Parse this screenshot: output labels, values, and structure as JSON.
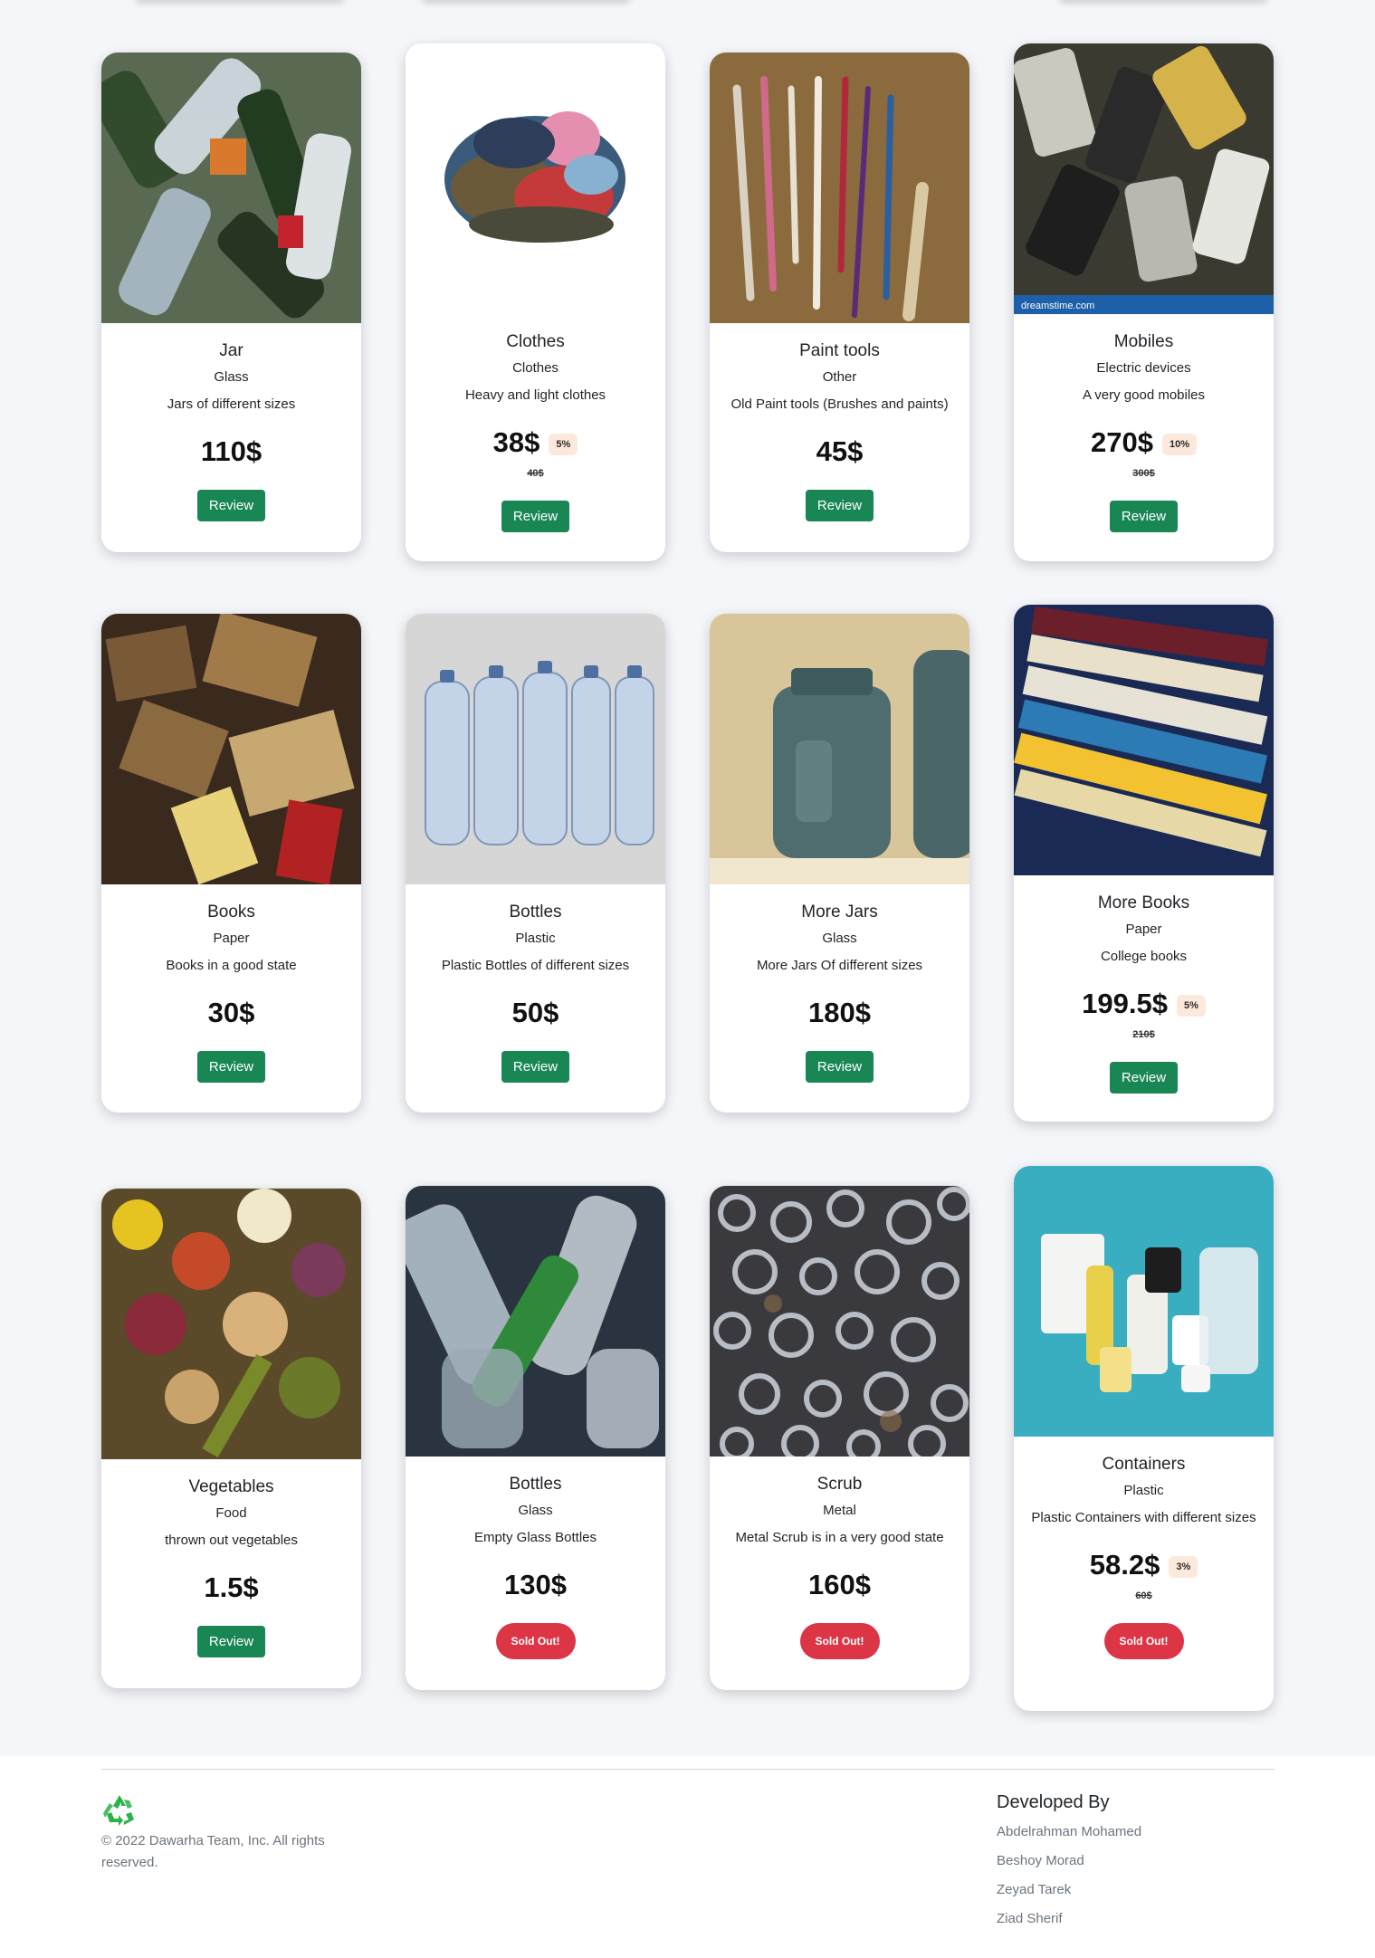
{
  "products": [
    {
      "name": "Jar",
      "category": "Glass",
      "description": "Jars of different sizes",
      "price": "110$",
      "discount": "",
      "old_price": "",
      "action": "Review",
      "image": "glass-bottles-pile"
    },
    {
      "name": "Clothes",
      "category": "Clothes",
      "description": "Heavy and light clothes",
      "price": "38$",
      "discount": "5%",
      "old_price": "40$",
      "action": "Review",
      "image": "clothes-pile"
    },
    {
      "name": "Paint tools",
      "category": "Other",
      "description": "Old Paint tools (Brushes and paints)",
      "price": "45$",
      "discount": "",
      "old_price": "",
      "action": "Review",
      "image": "paint-brushes"
    },
    {
      "name": "Mobiles",
      "category": "Electric devices",
      "description": "A very good mobiles",
      "price": "270$",
      "discount": "10%",
      "old_price": "300$",
      "action": "Review",
      "image": "old-mobiles"
    },
    {
      "name": "Books",
      "category": "Paper",
      "description": "Books in a good state",
      "price": "30$",
      "discount": "",
      "old_price": "",
      "action": "Review",
      "image": "books-boxes"
    },
    {
      "name": "Bottles",
      "category": "Plastic",
      "description": "Plastic Bottles of different sizes",
      "price": "50$",
      "discount": "",
      "old_price": "",
      "action": "Review",
      "image": "plastic-bottles"
    },
    {
      "name": "More Jars",
      "category": "Glass",
      "description": "More Jars Of different sizes",
      "price": "180$",
      "discount": "",
      "old_price": "",
      "action": "Review",
      "image": "mason-jars"
    },
    {
      "name": "More Books",
      "category": "Paper",
      "description": "College books",
      "price": "199.5$",
      "discount": "5%",
      "old_price": "210$",
      "action": "Review",
      "image": "college-books"
    },
    {
      "name": "Vegetables",
      "category": "Food",
      "description": "thrown out vegetables",
      "price": "1.5$",
      "discount": "",
      "old_price": "",
      "action": "Review",
      "image": "vegetable-scraps"
    },
    {
      "name": "Bottles",
      "category": "Glass",
      "description": "Empty Glass Bottles",
      "price": "130$",
      "discount": "",
      "old_price": "",
      "action": "Sold Out!",
      "image": "glass-bottles-green"
    },
    {
      "name": "Scrub",
      "category": "Metal",
      "description": "Metal Scrub is in a very good state",
      "price": "160$",
      "discount": "",
      "old_price": "",
      "action": "Sold Out!",
      "image": "metal-scrap"
    },
    {
      "name": "Containers",
      "category": "Plastic",
      "description": "Plastic Containers with different sizes",
      "price": "58.2$",
      "discount": "3%",
      "old_price": "60$",
      "action": "Sold Out!",
      "image": "plastic-containers"
    }
  ],
  "mobiles_watermark": "dreamstime.com",
  "footer": {
    "logo_icon": "recycle-icon",
    "copyright": "© 2022 Dawarha Team, Inc. All rights reserved.",
    "developed_by_title": "Developed By",
    "developers": [
      "Abdelrahman Mohamed",
      "Beshoy Morad",
      "Zeyad Tarek",
      "Ziad Sherif"
    ]
  },
  "colors": {
    "review_button": "#198754",
    "sold_button": "#dc3545",
    "badge_bg": "#fde8dc"
  }
}
